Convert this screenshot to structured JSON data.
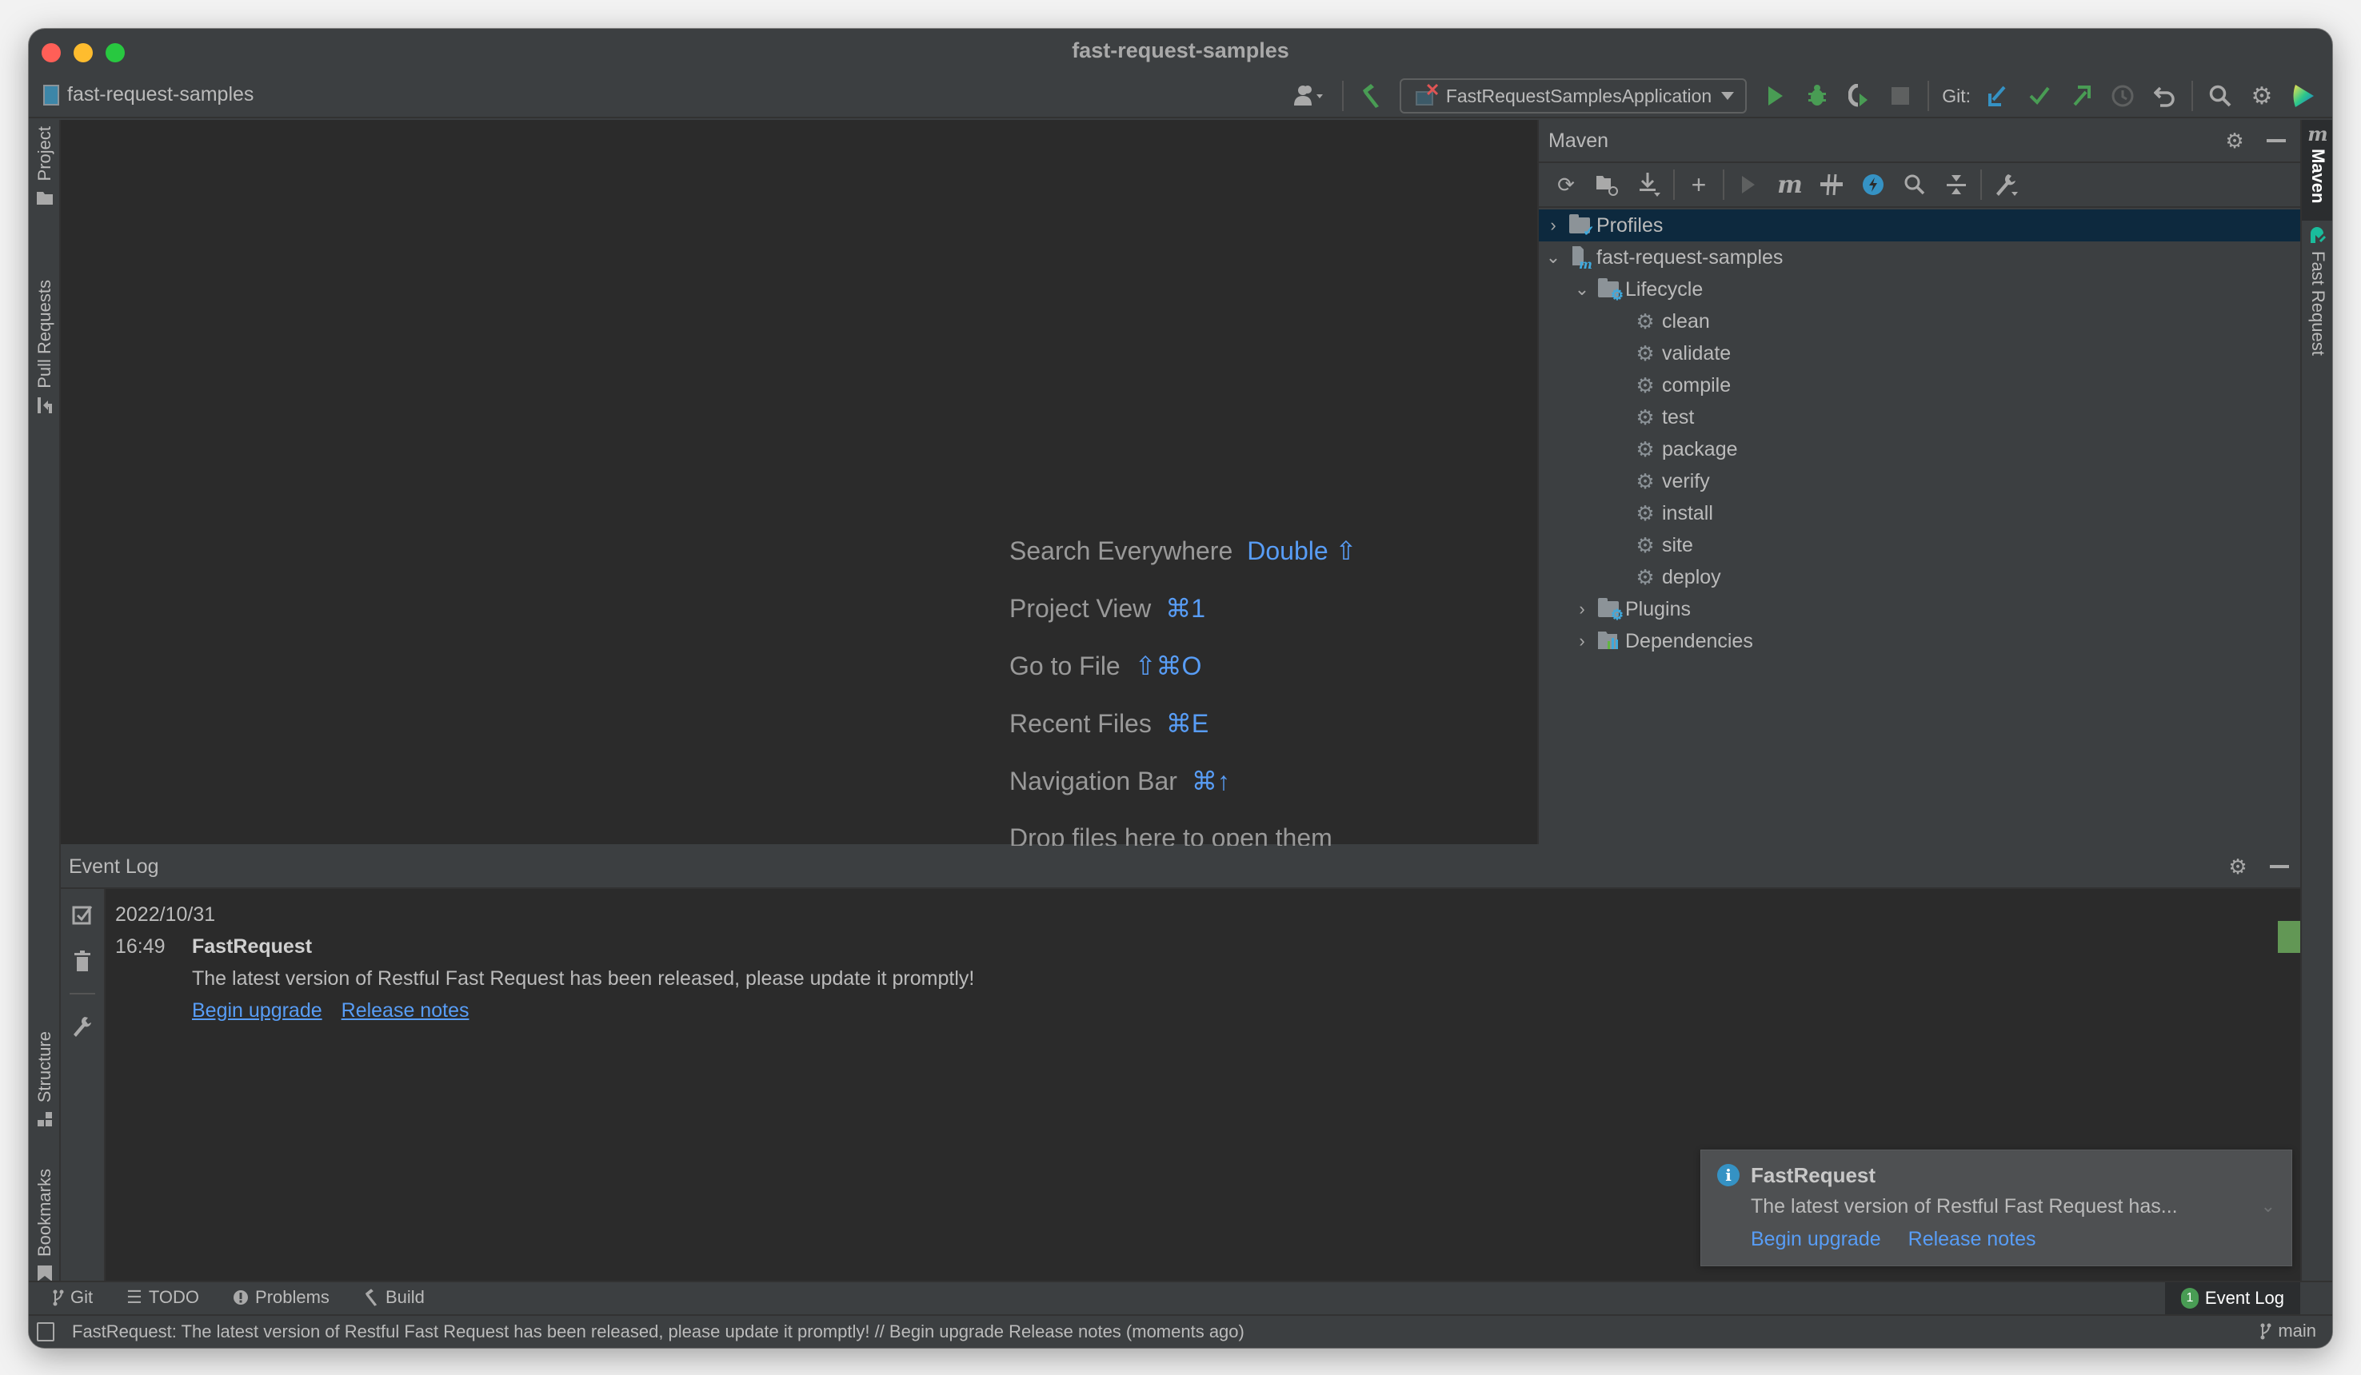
{
  "window": {
    "title": "fast-request-samples"
  },
  "toolbar": {
    "project_name": "fast-request-samples",
    "run_config": "FastRequestSamplesApplication",
    "git_label": "Git:",
    "icons": [
      "user-icon",
      "build-hammer-icon",
      "run-icon",
      "debug-icon",
      "run-coverage-icon",
      "stop-icon",
      "git-update-icon",
      "git-commit-icon",
      "git-push-icon",
      "history-icon",
      "rollback-icon",
      "search-icon",
      "settings-icon",
      "toolbox-icon"
    ]
  },
  "left_tool_strip": {
    "top": [
      {
        "label": "Project",
        "icon": "folder-icon"
      },
      {
        "label": "Pull Requests",
        "icon": "pull-request-icon"
      }
    ],
    "bottom": [
      {
        "label": "Structure",
        "icon": "structure-icon"
      },
      {
        "label": "Bookmarks",
        "icon": "bookmark-icon"
      }
    ]
  },
  "right_tool_strip": [
    {
      "label": "Maven",
      "icon": "maven-icon",
      "active": true
    },
    {
      "label": "Fast Request",
      "icon": "fast-request-icon",
      "active": false
    }
  ],
  "editor": {
    "hints": [
      {
        "label": "Search Everywhere",
        "shortcut": "Double ⇧"
      },
      {
        "label": "Project View",
        "shortcut": "⌘1"
      },
      {
        "label": "Go to File",
        "shortcut": "⇧⌘O"
      },
      {
        "label": "Recent Files",
        "shortcut": "⌘E"
      },
      {
        "label": "Navigation Bar",
        "shortcut": "⌘↑"
      },
      {
        "label": "Drop files here to open them",
        "shortcut": ""
      }
    ]
  },
  "maven": {
    "title": "Maven",
    "toolbar_icons": [
      "reload-icon",
      "generate-sources-icon",
      "download-icon",
      "add-icon",
      "run-icon",
      "execute-goal-icon",
      "toggle-offline-icon",
      "skip-tests-icon",
      "find-icon",
      "collapse-all-icon",
      "settings-wrench-icon"
    ],
    "tree": {
      "profiles": "Profiles",
      "project": "fast-request-samples",
      "lifecycle": "Lifecycle",
      "goals": [
        "clean",
        "validate",
        "compile",
        "test",
        "package",
        "verify",
        "install",
        "site",
        "deploy"
      ],
      "plugins": "Plugins",
      "dependencies": "Dependencies"
    }
  },
  "event_log": {
    "title": "Event Log",
    "date": "2022/10/31",
    "time": "16:49",
    "entry_title": "FastRequest",
    "message": "The latest version of Restful Fast Request has been released, please update it promptly!",
    "links": [
      "Begin upgrade",
      "Release notes"
    ],
    "marker_color": "#629755"
  },
  "notification": {
    "title": "FastRequest",
    "message": "The latest version of Restful Fast Request has...",
    "links": [
      "Begin upgrade",
      "Release notes"
    ]
  },
  "bottom_tools": {
    "items": [
      {
        "label": "Git",
        "icon": "git-branch-icon"
      },
      {
        "label": "TODO",
        "icon": "list-icon"
      },
      {
        "label": "Problems",
        "icon": "problems-icon"
      },
      {
        "label": "Build",
        "icon": "build-hammer-icon"
      }
    ],
    "event_log_label": "Event Log",
    "event_log_count": "1"
  },
  "status_bar": {
    "message": "FastRequest: The latest version of Restful Fast Request has been released, please update it promptly! // Begin upgrade   Release notes (moments ago)",
    "branch": "main"
  },
  "colors": {
    "accent_link": "#589df6",
    "selection": "#0d293e",
    "success_green": "#499c54"
  }
}
